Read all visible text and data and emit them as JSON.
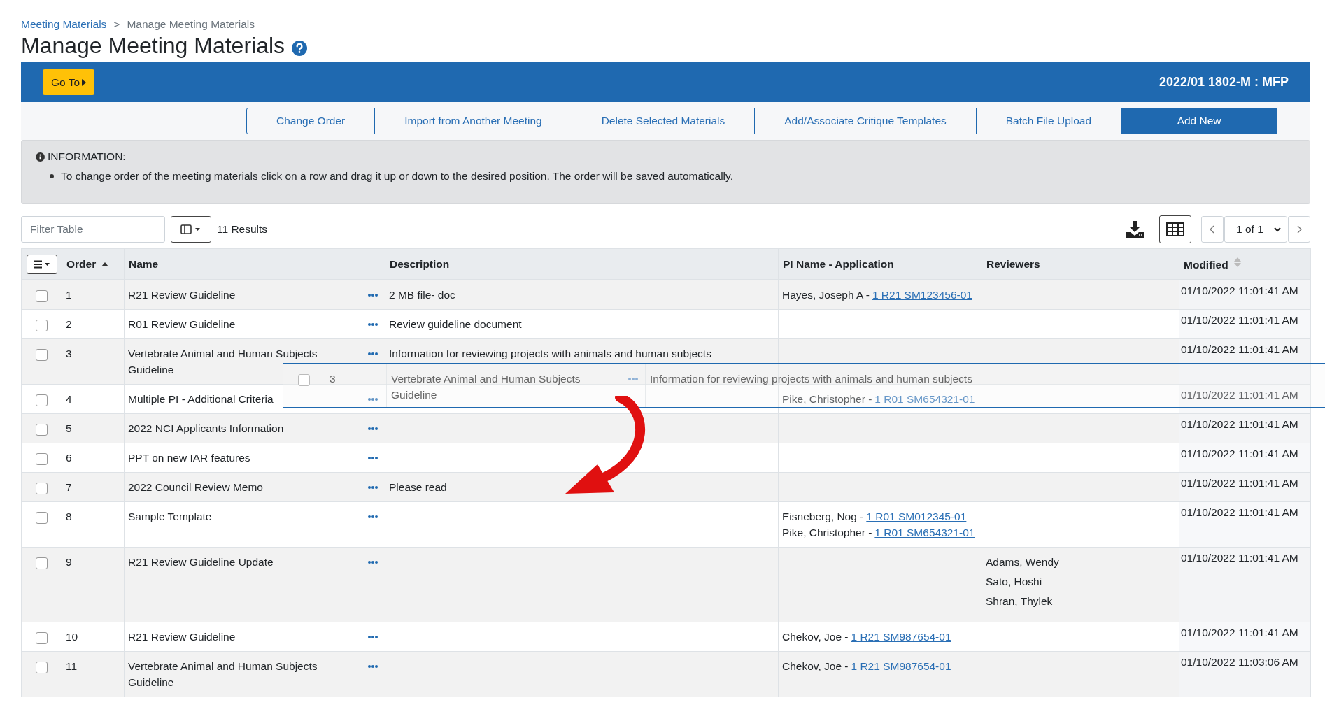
{
  "breadcrumb": {
    "items": [
      {
        "label": "Meeting Materials",
        "kind": "link"
      },
      {
        "label": "Manage Meeting Materials",
        "kind": "current"
      }
    ],
    "separator": ">"
  },
  "page_title": "Manage Meeting Materials",
  "header_bar": {
    "goto_button": "Go To",
    "meeting": "2022/01 1802-M : MFP"
  },
  "actions": [
    {
      "label": "Change Order",
      "primary": false
    },
    {
      "label": "Import from Another Meeting",
      "primary": false
    },
    {
      "label": "Delete Selected Materials",
      "primary": false
    },
    {
      "label": "Add/Associate Critique Templates",
      "primary": false
    },
    {
      "label": "Batch File Upload",
      "primary": false
    },
    {
      "label": "Add New",
      "primary": true
    }
  ],
  "info": {
    "title": "INFORMATION:",
    "bullets": [
      "To change order of the meeting materials click on a row and drag it up or down to the desired position. The order will be saved automatically."
    ]
  },
  "toolbar": {
    "filter": {
      "placeholder": "Filter Table"
    },
    "results": "11 Results",
    "page": "1 of 1"
  },
  "table": {
    "columns": [
      {
        "label": "Order",
        "sortable": true,
        "sorted": true
      },
      {
        "label": "Name",
        "sortable": false
      },
      {
        "label": "Description",
        "sortable": false
      },
      {
        "label": "PI Name - Application",
        "sortable": false
      },
      {
        "label": "Reviewers",
        "sortable": false
      },
      {
        "label": "Modified",
        "sortable": true,
        "sorted": false
      }
    ],
    "rows": [
      {
        "checked": false,
        "order": "1",
        "name": "R21 Review Guideline",
        "description": "2 MB file- doc",
        "pi": [
          {
            "name": "Hayes, Joseph A -",
            "application": "1 R21 SM123456-01"
          }
        ],
        "reviewers": [],
        "modified": "01/10/2022 11:01:41 AM"
      },
      {
        "checked": false,
        "order": "2",
        "name": "R01 Review Guideline",
        "description": "Review guideline document",
        "pi": [],
        "reviewers": [],
        "modified": "01/10/2022 11:01:41 AM"
      },
      {
        "checked": false,
        "order": "3",
        "name": "Vertebrate Animal and Human Subjects Guideline",
        "description": "Information for reviewing projects with animals and human subjects",
        "pi": [],
        "reviewers": [],
        "modified": "01/10/2022 11:01:41 AM"
      },
      {
        "checked": false,
        "order": "4",
        "name": "Multiple PI - Additional Criteria",
        "description": "",
        "pi": [
          {
            "name": "Pike, Christopher -",
            "application": "1 R01 SM654321-01"
          }
        ],
        "reviewers": [],
        "modified": "01/10/2022 11:01:41 AM"
      },
      {
        "checked": false,
        "order": "5",
        "name": "2022 NCI Applicants Information",
        "description": "",
        "pi": [],
        "reviewers": [],
        "modified": "01/10/2022 11:01:41 AM"
      },
      {
        "checked": false,
        "order": "6",
        "name": "PPT on new IAR features",
        "description": "",
        "pi": [],
        "reviewers": [],
        "modified": "01/10/2022 11:01:41 AM"
      },
      {
        "checked": false,
        "order": "7",
        "name": "2022 Council Review Memo",
        "description": "Please read",
        "pi": [],
        "reviewers": [],
        "modified": "01/10/2022 11:01:41 AM"
      },
      {
        "checked": false,
        "order": "8",
        "name": "Sample Template",
        "description": "",
        "pi": [
          {
            "name": "Eisneberg, Nog -",
            "application": "1 R01 SM012345-01"
          },
          {
            "name": "Pike, Christopher -",
            "application": "1 R01 SM654321-01"
          }
        ],
        "reviewers": [],
        "modified": "01/10/2022 11:01:41 AM"
      },
      {
        "checked": false,
        "order": "9",
        "name": "R21 Review Guideline Update",
        "description": "",
        "pi": [],
        "reviewers": [
          "Adams, Wendy",
          "Sato, Hoshi",
          "Shran, Thylek"
        ],
        "modified": "01/10/2022 11:01:41 AM"
      },
      {
        "checked": false,
        "order": "10",
        "name": "R21 Review Guideline",
        "description": "",
        "pi": [
          {
            "name": "Chekov, Joe -",
            "application": "1 R21 SM987654-01"
          }
        ],
        "reviewers": [],
        "modified": "01/10/2022 11:01:41 AM"
      },
      {
        "checked": false,
        "order": "11",
        "name": "Vertebrate Animal and Human Subjects Guideline",
        "description": "",
        "pi": [
          {
            "name": "Chekov, Joe -",
            "application": "1 R21 SM987654-01"
          }
        ],
        "reviewers": [],
        "modified": "01/10/2022 11:03:06 AM"
      }
    ]
  },
  "dragged_row": {
    "checked": false,
    "order": "3",
    "name": "Vertebrate Animal and Human Subjects Guideline",
    "description": "Information for reviewing projects with animals and human subjects"
  }
}
